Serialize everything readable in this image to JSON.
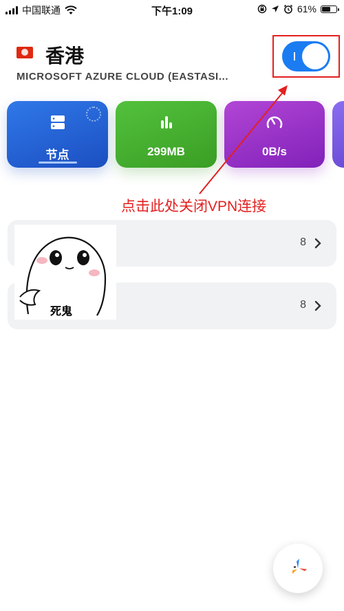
{
  "status_bar": {
    "carrier": "中国联通",
    "time": "下午1:09",
    "battery_text": "61%",
    "battery_level": 0.61
  },
  "header": {
    "flag_icon": "hong-kong-flag-icon",
    "title": "香港",
    "subtitle": "MICROSOFT AZURE CLOUD (EASTASI...",
    "toggle_on": true
  },
  "cards": [
    {
      "label": "节点",
      "icon": "server-icon",
      "color": "#2f78e9"
    },
    {
      "label": "299MB",
      "icon": "bar-chart-icon",
      "color": "#53c13d"
    },
    {
      "label": "0B/s",
      "icon": "speedometer-icon",
      "color": "#b246d6"
    }
  ],
  "annotation": {
    "text": "点击此处关闭VPN连接",
    "color": "#e32020"
  },
  "list": [
    {
      "count": "8"
    },
    {
      "count": "8"
    }
  ],
  "sticker": {
    "caption": "死鬼"
  },
  "accent": "#1b7cf2"
}
